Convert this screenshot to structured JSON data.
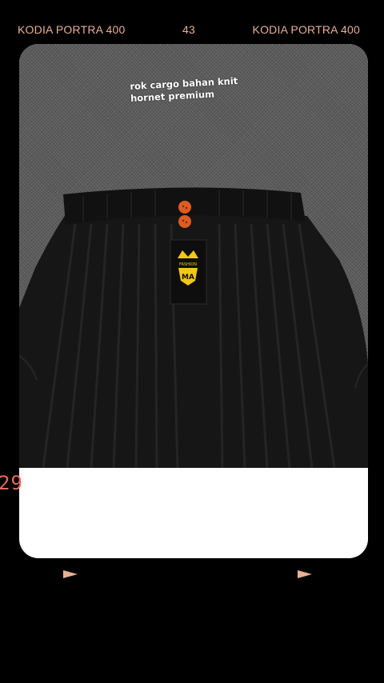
{
  "film_header": {
    "left_label": "KODIA PORTRA 400",
    "frame_number": "43",
    "right_label": "KODIA PORTRA 400"
  },
  "photo": {
    "caption": "rok cargo bahan knit hornet premium",
    "brand_tag_text": "FASHION"
  },
  "frame_counter": "29",
  "icons": {
    "left_arrow": "play-arrow-icon",
    "right_arrow": "play-arrow-icon"
  },
  "colors": {
    "label": "#e7b193",
    "counter": "#e26a5a",
    "background": "#000000",
    "frame": "#ffffff"
  }
}
